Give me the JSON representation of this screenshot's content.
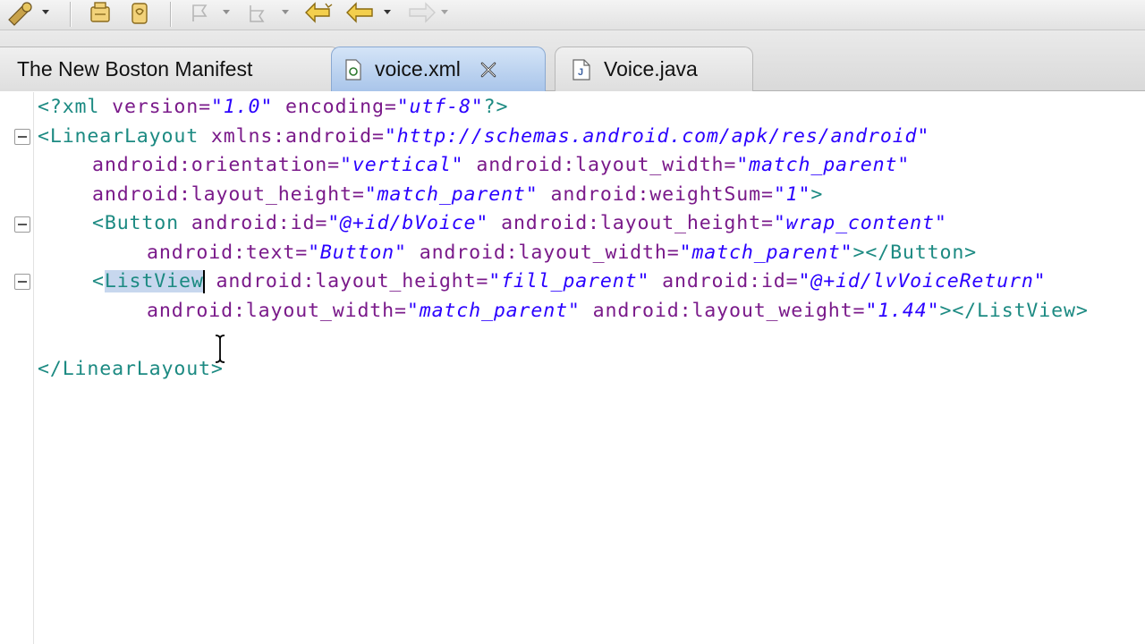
{
  "tabs": [
    {
      "label": "The New Boston Manifest",
      "active": false
    },
    {
      "label": "voice.xml",
      "active": true
    },
    {
      "label": "Voice.java",
      "active": false
    }
  ],
  "code": {
    "line1": {
      "open": "<?xml ",
      "a1": "version=",
      "v1": "\"1.0\"",
      "a2": " encoding=",
      "v2": "\"utf-8\"",
      "close": "?>"
    },
    "line2": {
      "tag": "<LinearLayout",
      "a1": " xmlns:android=",
      "v1": "\"http://schemas.android.com/apk/res/android\""
    },
    "line3": {
      "a1": "android:orientation=",
      "v1": "\"vertical\"",
      "a2": " android:layout_width=",
      "v2": "\"match_parent\""
    },
    "line4": {
      "a1": "android:layout_height=",
      "v1": "\"match_parent\"",
      "a2": " android:weightSum=",
      "v2": "\"1\"",
      "close": ">"
    },
    "line5": {
      "tag": "<Button",
      "a1": " android:id=",
      "v1": "\"@+id/bVoice\"",
      "a2": " android:layout_height=",
      "v2": "\"wrap_content\""
    },
    "line6": {
      "a1": "android:text=",
      "v1": "\"Button\"",
      "a2": " android:layout_width=",
      "v2": "\"match_parent\"",
      "close": "></Button>"
    },
    "line7": {
      "lt": "<",
      "tag": "ListView",
      "a1": " android:layout_height=",
      "v1": "\"fill_parent\"",
      "a2": " android:id=",
      "v2": "\"@+id/lvVoiceReturn\""
    },
    "line8": {
      "a1": "android:layout_width=",
      "v1": "\"match_parent\"",
      "a2": " android:layout_weight=",
      "v2": "\"1.44\"",
      "close": "></ListView>"
    },
    "line10": {
      "tag": "</LinearLayout>"
    }
  },
  "colors": {
    "tag": "#1c8a82",
    "attribute": "#7a1a8a",
    "value": "#2a00ff",
    "active_tab": "#a9c5ea"
  }
}
